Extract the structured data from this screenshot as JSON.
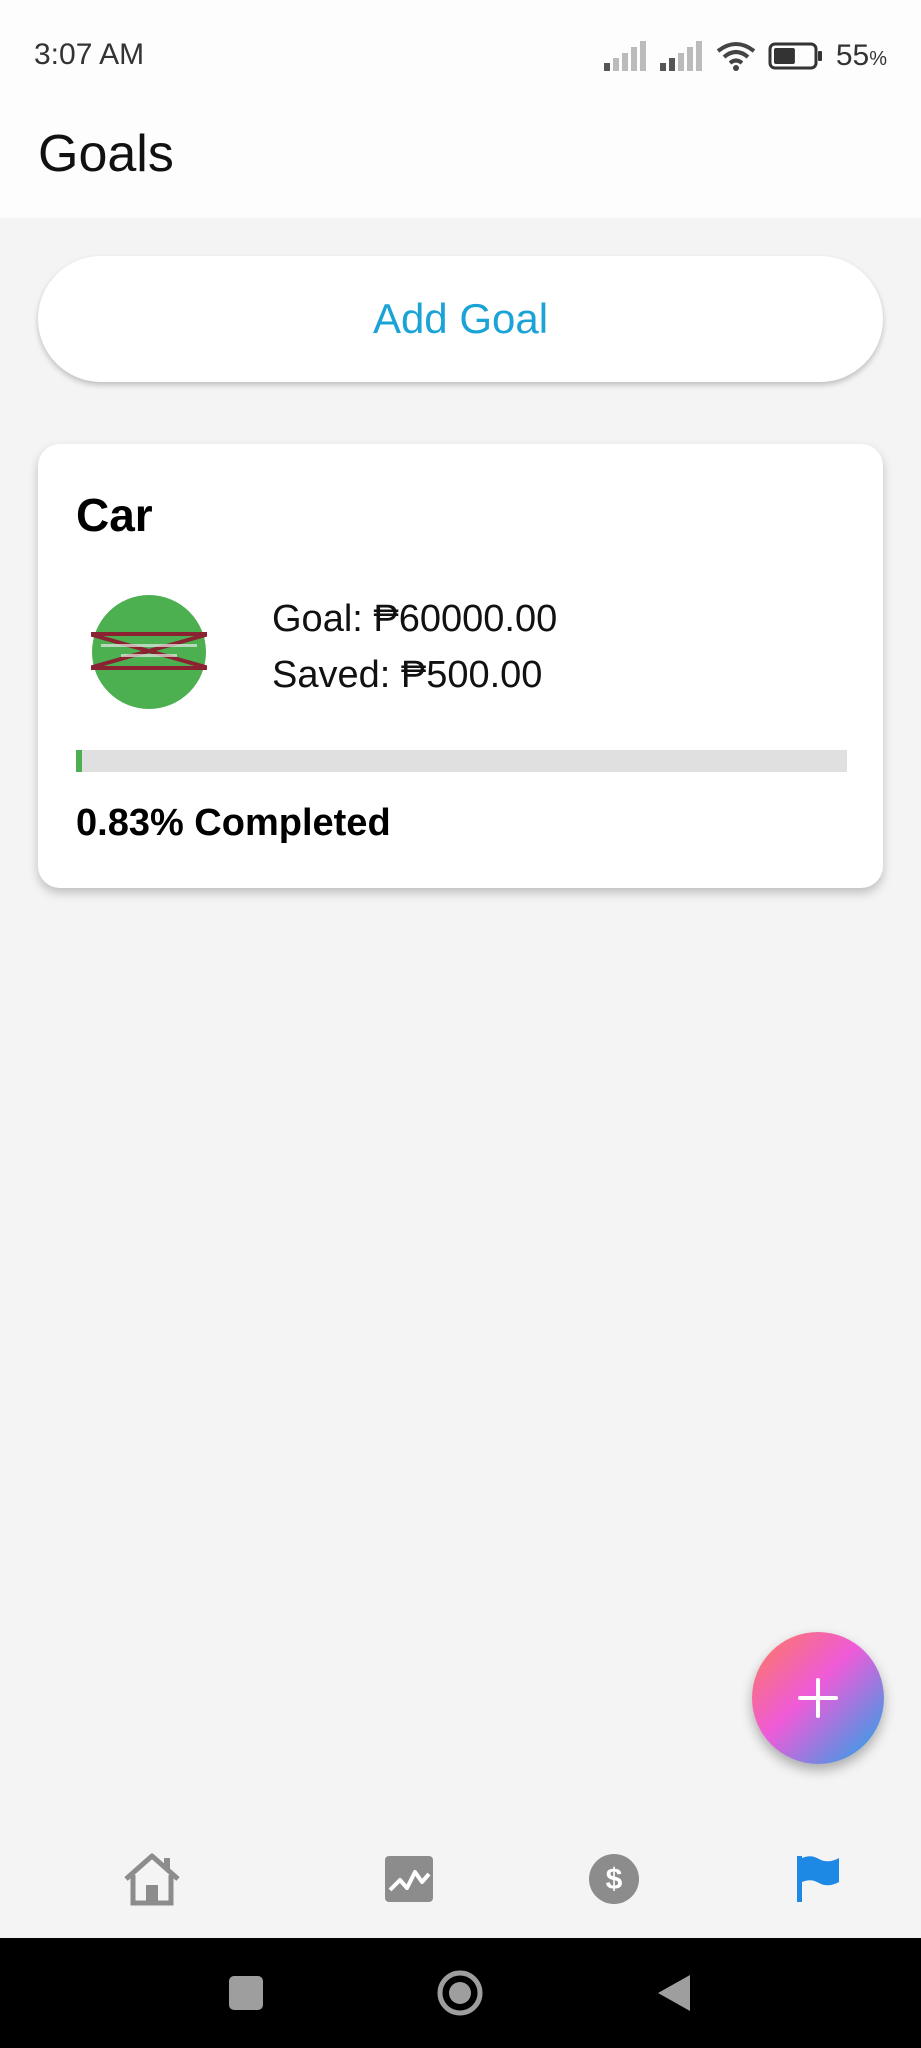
{
  "status_bar": {
    "time": "3:07 AM",
    "battery_percent": "55",
    "battery_unit": "%",
    "battery_level": 0.55,
    "icons": [
      "signal-icon",
      "signal-icon",
      "wifi-icon",
      "battery-icon"
    ]
  },
  "header": {
    "title": "Goals"
  },
  "add_goal": {
    "label": "Add Goal"
  },
  "goal_card": {
    "name": "Car",
    "goal_text": "Goal: ₱60000.00",
    "saved_text": "Saved: ₱500.00",
    "progress": 0.0083,
    "completed_text": "0.83% Completed",
    "image_icon": "broken-image-icon"
  },
  "fab": {
    "icon": "plus-icon"
  },
  "bottom_nav": {
    "items": [
      {
        "name": "home",
        "icon": "home-icon",
        "active": false
      },
      {
        "name": "analytics",
        "icon": "chart-icon",
        "active": false
      },
      {
        "name": "money",
        "icon": "dollar-icon",
        "active": false
      },
      {
        "name": "goals",
        "icon": "flag-icon",
        "active": true
      }
    ]
  },
  "colors": {
    "accent_blue": "#1aa3d6",
    "progress_green": "#4caf50",
    "nav_active": "#1e88e5",
    "nav_inactive": "#8c8c8c"
  }
}
